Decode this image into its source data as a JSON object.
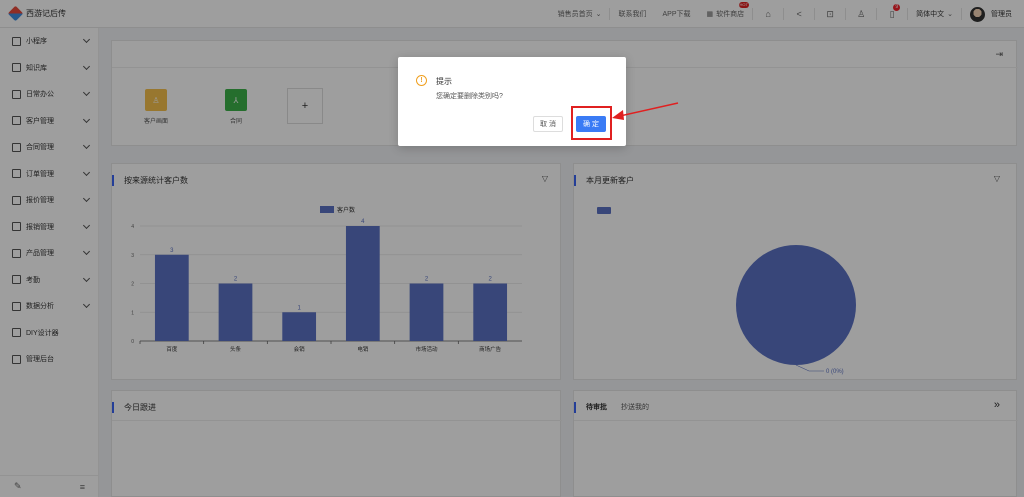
{
  "app": {
    "title": "西游记后传"
  },
  "topnav": {
    "links": [
      "销售员首页",
      "联系我们",
      "APP下载",
      "软件商店"
    ],
    "badge_store": "HOT",
    "notify_count": "9",
    "language": "简体中文",
    "user": "管理员"
  },
  "sidebar": {
    "items": [
      {
        "label": "小程序",
        "expandable": true
      },
      {
        "label": "知识库",
        "expandable": true
      },
      {
        "label": "日常办公",
        "expandable": true
      },
      {
        "label": "客户管理",
        "expandable": true
      },
      {
        "label": "合同管理",
        "expandable": true
      },
      {
        "label": "订单管理",
        "expandable": true
      },
      {
        "label": "报价管理",
        "expandable": true
      },
      {
        "label": "报销管理",
        "expandable": true
      },
      {
        "label": "产品管理",
        "expandable": true
      },
      {
        "label": "考勤",
        "expandable": true
      },
      {
        "label": "数据分析",
        "expandable": true
      },
      {
        "label": "DIY设计器",
        "expandable": false
      },
      {
        "label": "管理后台",
        "expandable": false
      }
    ]
  },
  "shortcuts": [
    {
      "label": "客户画面",
      "icon": "person-icon",
      "color": "#f5c14c"
    },
    {
      "label": "合同",
      "icon": "network-icon",
      "color": "#3db24a"
    }
  ],
  "cards": {
    "source_chart_title": "按来源统计客户数",
    "monthly_title": "本月更新客户",
    "today_title": "今日跟进",
    "tabs": [
      "待审批",
      "抄送我的"
    ]
  },
  "chart_data": [
    {
      "type": "bar",
      "categories": [
        "百度",
        "头条",
        "会销",
        "电销",
        "市场活动",
        "商场广告"
      ],
      "series": [
        {
          "name": "客户数",
          "values": [
            3,
            2,
            1,
            4,
            2,
            2
          ]
        }
      ],
      "ylim": [
        0,
        4
      ],
      "yticks": [
        0,
        1,
        2,
        3,
        4
      ],
      "color": "#5b72c4"
    },
    {
      "type": "pie",
      "slices": [
        {
          "label": "0",
          "value": 0,
          "percent": "0%"
        }
      ],
      "label_text": "0 (0%)",
      "color": "#5b72c4"
    }
  ],
  "dialog": {
    "title": "提示",
    "message": "您确定要删除类别吗?",
    "cancel": "取 消",
    "ok": "确 定"
  }
}
